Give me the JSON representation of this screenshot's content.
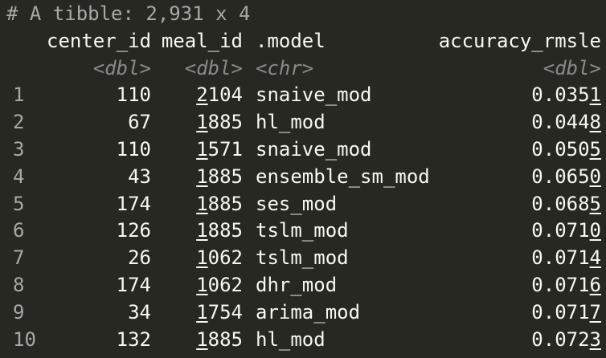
{
  "console": {
    "header_comment": "# A tibble: 2,931 x 4",
    "columns": [
      {
        "name": "center_id",
        "type": "<dbl>"
      },
      {
        "name": "meal_id",
        "type": "<dbl>"
      },
      {
        "name": ".model",
        "type": "<chr>"
      },
      {
        "name": "accuracy_rmsle",
        "type": "<dbl>"
      }
    ],
    "rows": [
      {
        "n": "1",
        "center_id": "110",
        "meal_id": "2104",
        ".model": "snaive_mod",
        "accuracy_rmsle": "0.0351"
      },
      {
        "n": "2",
        "center_id": "67",
        "meal_id": "1885",
        ".model": "hl_mod",
        "accuracy_rmsle": "0.0448"
      },
      {
        "n": "3",
        "center_id": "110",
        "meal_id": "1571",
        ".model": "snaive_mod",
        "accuracy_rmsle": "0.0505"
      },
      {
        "n": "4",
        "center_id": "43",
        "meal_id": "1885",
        ".model": "ensemble_sm_mod",
        "accuracy_rmsle": "0.0650"
      },
      {
        "n": "5",
        "center_id": "174",
        "meal_id": "1885",
        ".model": "ses_mod",
        "accuracy_rmsle": "0.0685"
      },
      {
        "n": "6",
        "center_id": "126",
        "meal_id": "1885",
        ".model": "tslm_mod",
        "accuracy_rmsle": "0.0710"
      },
      {
        "n": "7",
        "center_id": "26",
        "meal_id": "1062",
        ".model": "tslm_mod",
        "accuracy_rmsle": "0.0714"
      },
      {
        "n": "8",
        "center_id": "174",
        "meal_id": "1062",
        ".model": "dhr_mod",
        "accuracy_rmsle": "0.0716"
      },
      {
        "n": "9",
        "center_id": "34",
        "meal_id": "1754",
        ".model": "arima_mod",
        "accuracy_rmsle": "0.0717"
      },
      {
        "n": "10",
        "center_id": "132",
        "meal_id": "1885",
        ".model": "hl_mod",
        "accuracy_rmsle": "0.0723"
      }
    ]
  }
}
